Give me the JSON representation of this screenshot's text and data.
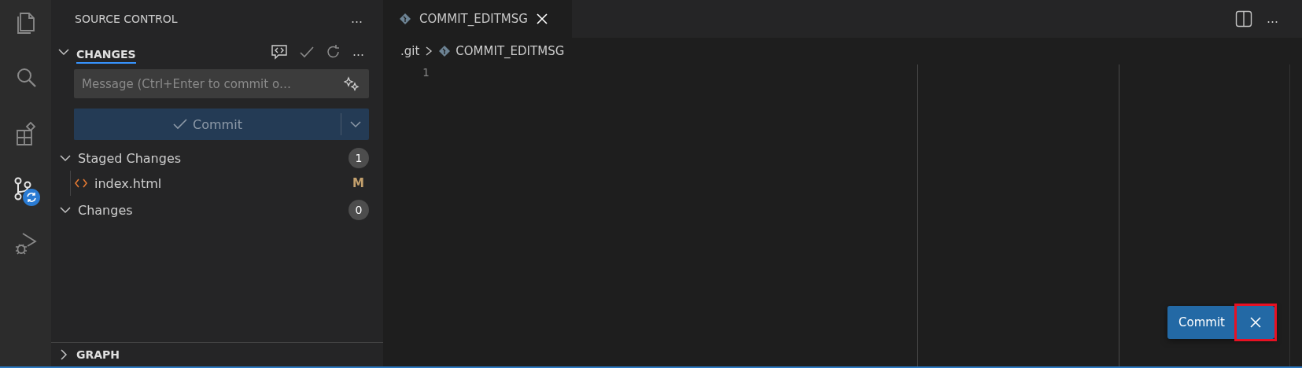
{
  "activity_bar": [
    {
      "kind": "files",
      "selected": false
    },
    {
      "kind": "search",
      "selected": false
    },
    {
      "kind": "extensions",
      "selected": false
    },
    {
      "kind": "source-control",
      "selected": true,
      "badge": true
    },
    {
      "kind": "run-debug",
      "selected": false
    }
  ],
  "sidebar": {
    "title": "SOURCE CONTROL",
    "menu": "…",
    "section": {
      "title": "CHANGES",
      "expanded": true
    },
    "message": {
      "placeholder": "Message (Ctrl+Enter to commit o…"
    },
    "commit_button": {
      "label": "Commit",
      "disabled": true
    },
    "groups": [
      {
        "label": "Staged Changes",
        "count": "1",
        "expanded": true,
        "children": [
          {
            "name": "index.html",
            "status": "M"
          }
        ]
      },
      {
        "label": "Changes",
        "count": "0",
        "expanded": true
      }
    ],
    "graph": {
      "title": "GRAPH",
      "expanded": false
    }
  },
  "editor": {
    "tabs": [
      {
        "label": "COMMIT_EDITMSG",
        "selected": true
      }
    ],
    "breadcrumb": [
      ".git",
      "COMMIT_EDITMSG"
    ],
    "line_numbers": [
      "1"
    ],
    "overlay": {
      "commit_label": "Commit",
      "close_highlighted": true
    }
  }
}
